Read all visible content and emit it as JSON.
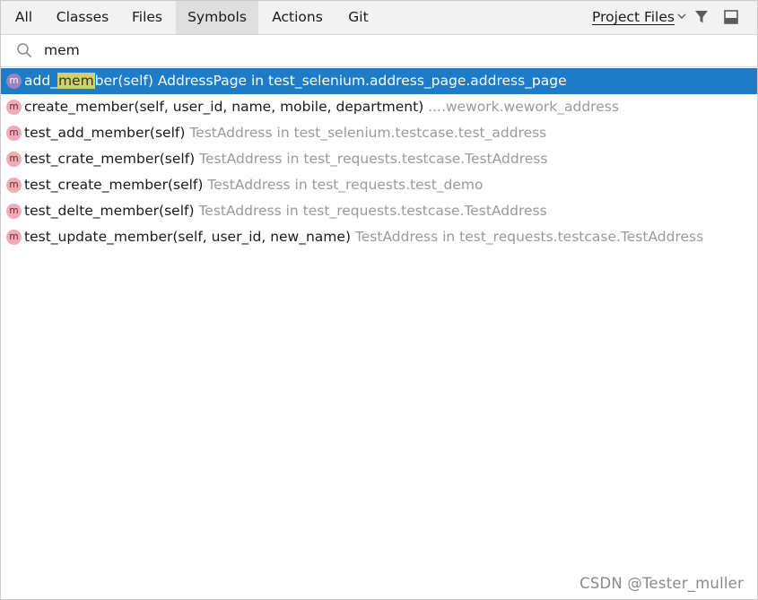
{
  "tabs": [
    {
      "label": "All"
    },
    {
      "label": "Classes"
    },
    {
      "label": "Files"
    },
    {
      "label": "Symbols"
    },
    {
      "label": "Actions"
    },
    {
      "label": "Git"
    }
  ],
  "active_tab": "Symbols",
  "scope": {
    "label": "Project Files"
  },
  "search": {
    "value": "mem"
  },
  "results": [
    {
      "badge": "m",
      "name_before": "add_",
      "name_match": "mem",
      "name_after": "ber(self)",
      "location": " AddressPage in test_selenium.address_page.address_page",
      "selected": true
    },
    {
      "badge": "m",
      "signature": "create_member(self, user_id, name, mobile, department)",
      "location": " ....wework.wework_address"
    },
    {
      "badge": "m",
      "signature": "test_add_member(self)",
      "location": " TestAddress in test_selenium.testcase.test_address"
    },
    {
      "badge": "m",
      "signature": "test_crate_member(self)",
      "location": " TestAddress in test_requests.testcase.TestAddress"
    },
    {
      "badge": "m",
      "signature": "test_create_member(self)",
      "location": " TestAddress in test_requests.test_demo"
    },
    {
      "badge": "m",
      "signature": "test_delte_member(self)",
      "location": " TestAddress in test_requests.testcase.TestAddress"
    },
    {
      "badge": "m",
      "signature": "test_update_member(self, user_id, new_name)",
      "location": " TestAddress in test_requests.testcase.TestAddress"
    }
  ],
  "watermark": "CSDN @Tester_muller",
  "colors": {
    "selection": "#1e7bc6",
    "method_badge": "#f3aab8",
    "match_highlight": "#cfcf7a",
    "location_text": "#9a9a9a"
  },
  "icons": [
    "search-icon",
    "chevron-down-icon",
    "filter-icon",
    "panel-icon"
  ]
}
